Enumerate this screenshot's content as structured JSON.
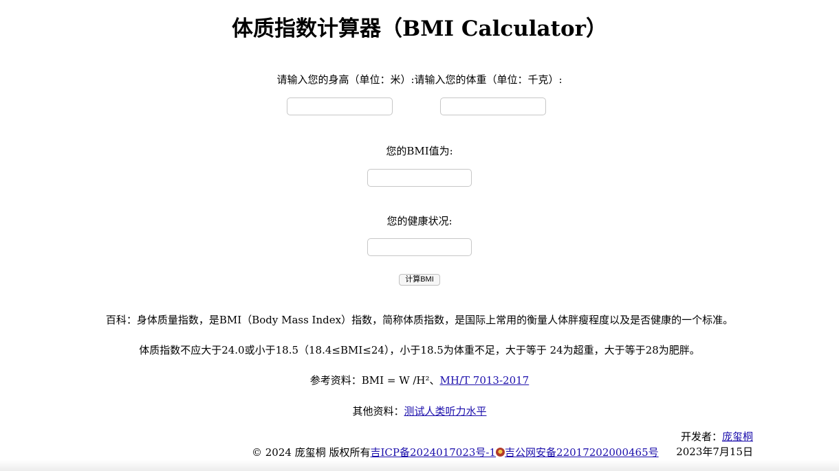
{
  "page": {
    "title": "体质指数计算器（BMI Calculator）"
  },
  "form": {
    "height_label": "请输入您的身高（单位：米）:",
    "weight_label": "请输入您的体重（单位：千克）:",
    "height_value": "",
    "weight_value": "",
    "bmi_label": "您的BMI值为:",
    "bmi_value": "",
    "health_label": "您的健康状况:",
    "health_value": "",
    "calculate_button": "计算BMI"
  },
  "info": {
    "encyclopedia": "百科：身体质量指数，是BMI（Body Mass Index）指数，简称体质指数，是国际上常用的衡量人体胖瘦程度以及是否健康的一个标准。",
    "range": "体质指数不应大于24.0或小于18.5（18.4≤BMI≤24），小于18.5为体重不足，大于等于 24为超重，大于等于28为肥胖。",
    "reference_prefix": "参考资料：BMI = W /H²、",
    "reference_link": "MH/T 7013-2017",
    "other_prefix": "其他资料：",
    "other_link": "测试人类听力水平"
  },
  "developer": {
    "label": "开发者：",
    "name": "庞玺桐",
    "date": "2023年7月15日"
  },
  "footer": {
    "copyright": "© 2024 庞玺桐 版权所有",
    "icp": "吉ICP备2024017023号-1",
    "police": "吉公网安备22017202000465号"
  },
  "colors": {
    "link": "#1a0dab",
    "police_badge": "#b23a2a"
  }
}
